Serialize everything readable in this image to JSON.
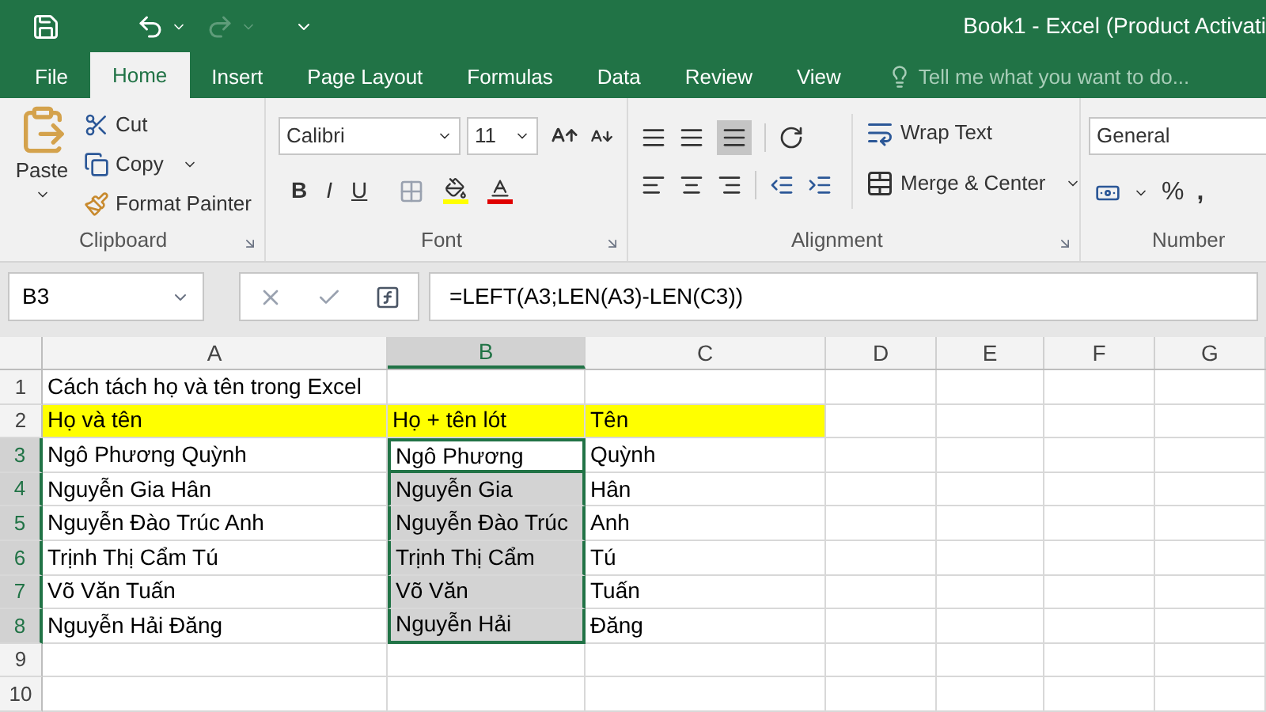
{
  "window": {
    "title": "Book1 - Excel (Product Activati"
  },
  "tabs": [
    {
      "label": "File",
      "selected": false
    },
    {
      "label": "Home",
      "selected": true
    },
    {
      "label": "Insert",
      "selected": false
    },
    {
      "label": "Page Layout",
      "selected": false
    },
    {
      "label": "Formulas",
      "selected": false
    },
    {
      "label": "Data",
      "selected": false
    },
    {
      "label": "Review",
      "selected": false
    },
    {
      "label": "View",
      "selected": false
    }
  ],
  "tell_me": {
    "placeholder": "Tell me what you want to do..."
  },
  "ribbon": {
    "clipboard": {
      "paste": "Paste",
      "cut": "Cut",
      "copy": "Copy",
      "format_painter": "Format Painter",
      "label": "Clipboard"
    },
    "font": {
      "font_name": "Calibri",
      "font_size": "11",
      "bold": "B",
      "italic": "I",
      "underline": "U",
      "label": "Font"
    },
    "alignment": {
      "wrap_text": "Wrap Text",
      "merge_center": "Merge & Center",
      "label": "Alignment"
    },
    "number": {
      "format": "General",
      "percent": "%",
      "comma": ",",
      "label": "Number"
    }
  },
  "formula_bar": {
    "name_box": "B3",
    "formula": "=LEFT(A3;LEN(A3)-LEN(C3))"
  },
  "sheet": {
    "columns": [
      {
        "label": "A",
        "selected": false
      },
      {
        "label": "B",
        "selected": true
      },
      {
        "label": "C",
        "selected": false
      },
      {
        "label": "D",
        "selected": false
      },
      {
        "label": "E",
        "selected": false
      },
      {
        "label": "F",
        "selected": false
      },
      {
        "label": "G",
        "selected": false
      }
    ],
    "rows": [
      {
        "number": "1",
        "selected": false,
        "highlighted": false,
        "cells": [
          {
            "text": "Cách tách họ và tên trong Excel",
            "selected": false,
            "active": false
          }
        ]
      },
      {
        "number": "2",
        "selected": false,
        "highlighted": true,
        "cells": [
          {
            "text": "Họ và tên",
            "selected": false,
            "active": false
          },
          {
            "text": "Họ + tên lót",
            "selected": false,
            "active": false
          },
          {
            "text": "Tên",
            "selected": false,
            "active": false
          }
        ]
      },
      {
        "number": "3",
        "selected": true,
        "highlighted": false,
        "cells": [
          {
            "text": "Ngô Phương Quỳnh",
            "selected": false,
            "active": false
          },
          {
            "text": "Ngô Phương",
            "selected": true,
            "active": true
          },
          {
            "text": "Quỳnh",
            "selected": false,
            "active": false
          }
        ]
      },
      {
        "number": "4",
        "selected": true,
        "highlighted": false,
        "cells": [
          {
            "text": "Nguyễn Gia Hân",
            "selected": false,
            "active": false
          },
          {
            "text": "Nguyễn Gia",
            "selected": true,
            "active": false
          },
          {
            "text": "Hân",
            "selected": false,
            "active": false
          }
        ]
      },
      {
        "number": "5",
        "selected": true,
        "highlighted": false,
        "cells": [
          {
            "text": "Nguyễn Đào Trúc Anh",
            "selected": false,
            "active": false
          },
          {
            "text": "Nguyễn Đào Trúc",
            "selected": true,
            "active": false
          },
          {
            "text": "Anh",
            "selected": false,
            "active": false
          }
        ]
      },
      {
        "number": "6",
        "selected": true,
        "highlighted": false,
        "cells": [
          {
            "text": "Trịnh Thị Cẩm Tú",
            "selected": false,
            "active": false
          },
          {
            "text": "Trịnh Thị Cẩm",
            "selected": true,
            "active": false
          },
          {
            "text": "Tú",
            "selected": false,
            "active": false
          }
        ]
      },
      {
        "number": "7",
        "selected": true,
        "highlighted": false,
        "cells": [
          {
            "text": "Võ Văn Tuấn",
            "selected": false,
            "active": false
          },
          {
            "text": "Võ Văn",
            "selected": true,
            "active": false
          },
          {
            "text": "Tuấn",
            "selected": false,
            "active": false
          }
        ]
      },
      {
        "number": "8",
        "selected": true,
        "highlighted": false,
        "cells": [
          {
            "text": "Nguyễn Hải Đăng",
            "selected": false,
            "active": false
          },
          {
            "text": "Nguyễn Hải",
            "selected": true,
            "active": false
          },
          {
            "text": "Đăng",
            "selected": false,
            "active": false
          }
        ]
      },
      {
        "number": "9",
        "selected": false,
        "highlighted": false,
        "cells": []
      },
      {
        "number": "10",
        "selected": false,
        "highlighted": false,
        "cells": []
      }
    ]
  }
}
